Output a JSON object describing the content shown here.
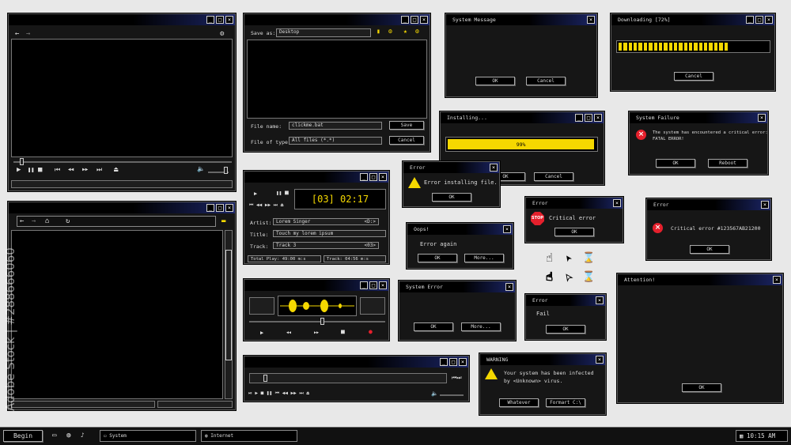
{
  "titlebar_controls": {
    "min": "_",
    "max": "□",
    "close": "×"
  },
  "player_a": {
    "back": "←",
    "forward": "→",
    "gear": "⚙",
    "play": "▶",
    "pause": "❚❚",
    "stop": "■",
    "prev": "⏮",
    "rew": "◀◀",
    "ffw": "▶▶",
    "next": "⏭",
    "eject": "⏏",
    "vol": "🔈"
  },
  "save_dialog": {
    "save_as_label": "Save as:",
    "save_as_value": "Desktop",
    "file_name_label": "File name:",
    "file_name_value": "clickme.bat",
    "file_type_label": "File of type:",
    "file_type_value": "All files (*.*)",
    "save_btn": "Save",
    "cancel_btn": "Cancel"
  },
  "system_message": {
    "title": "System Message",
    "ok": "OK",
    "cancel": "Cancel"
  },
  "downloading": {
    "title": "Downloading [72%]",
    "cancel": "Cancel",
    "progress": 0.72
  },
  "installing": {
    "title": "Installing...",
    "percent_text": "99%",
    "progress": 0.99,
    "ok": "OK",
    "cancel": "Cancel"
  },
  "system_failure": {
    "title": "System Failure",
    "line1": "The system has encountered a critical error:",
    "line2": "FATAL ERROR!",
    "ok": "OK",
    "reboot": "Reboot"
  },
  "browser": {
    "back": "←",
    "forward": "→",
    "home": "⌂",
    "refresh": "↻",
    "folder": "▬"
  },
  "music_player": {
    "time": "[03] 02:17",
    "artist_label": "Artist:",
    "artist_value": "Lorem Singer",
    "artist_tag": "<D:>",
    "title_label": "Title:",
    "title_value": "Touch my lorem ipsum",
    "track_label": "Track:",
    "track_value": "Track 3",
    "track_tag": "<03>",
    "total_play": "Total Play: 49:00 m:s",
    "track_time": "Track: 04:56 m:s"
  },
  "error_install": {
    "title": "Error",
    "message": "Error installing file.",
    "ok": "OK"
  },
  "oops": {
    "title": "Oops!",
    "message": "Error again",
    "ok": "OK",
    "more": "More..."
  },
  "error_stop": {
    "title": "Error",
    "stop": "STOP",
    "message": "Critical error",
    "ok": "OK"
  },
  "critical_error": {
    "title": "Error",
    "message": "Critical error #123567AB21200",
    "ok": "OK"
  },
  "system_error": {
    "title": "System Error",
    "ok": "OK",
    "more": "More..."
  },
  "error_fail": {
    "title": "Error",
    "message": "Fail",
    "ok": "OK"
  },
  "attention": {
    "title": "Attention!",
    "ok": "OK"
  },
  "warning": {
    "title": "WARNING",
    "line1": "Your system has been infected",
    "line2": "by <Unknown> virus.",
    "whatever": "Whatever",
    "format": "Formart C:\\"
  },
  "cursors": {
    "hand": "☝",
    "arrow": "➤",
    "hourglass": "⌛"
  },
  "taskbar": {
    "begin": "Begin",
    "system": "System",
    "internet": "Internet",
    "clock": "10:15 AM"
  },
  "watermark": {
    "brand": "Adobe Stock",
    "id": "#288666060"
  }
}
